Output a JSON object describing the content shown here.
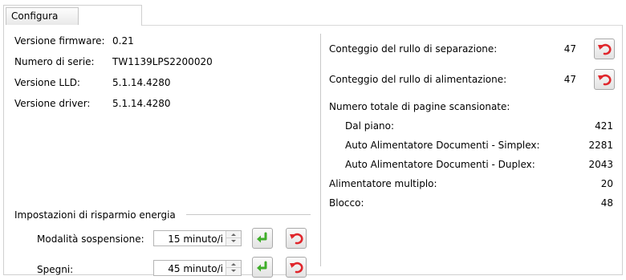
{
  "tabs": [
    {
      "label": "Configura",
      "selected": true
    }
  ],
  "device_info": {
    "firmware_label": "Versione firmware:",
    "firmware_value": "0.21",
    "serial_label": "Numero di serie:",
    "serial_value": "TW1139LPS2200020",
    "lld_label": "Versione LLD:",
    "lld_value": "5.1.14.4280",
    "driver_label": "Versione driver:",
    "driver_value": "5.1.14.4280"
  },
  "power_saving": {
    "title": "Impostazioni di risparmio energia",
    "sleep_label": "Modalità sospensione:",
    "sleep_value": "15 minuto/i",
    "off_label": "Spegni:",
    "off_value": "45 minuto/i"
  },
  "counters": {
    "separation_label": "Conteggio del rullo di separazione:",
    "separation_value": "47",
    "feed_label": "Conteggio del rullo di alimentazione:",
    "feed_value": "47",
    "total_pages_label": "Numero totale di pagine scansionate:",
    "flatbed_label": "Dal piano:",
    "flatbed_value": "421",
    "adf_simplex_label": "Auto Alimentatore Documenti - Simplex:",
    "adf_simplex_value": "2281",
    "adf_duplex_label": "Auto Alimentatore Documenti - Duplex:",
    "adf_duplex_value": "2043",
    "multifeed_label": "Alimentatore multiplo:",
    "multifeed_value": "20",
    "jam_label": "Blocco:",
    "jam_value": "48"
  },
  "icons": {
    "apply": "enter-arrow-icon",
    "reset": "undo-arrow-icon",
    "apply_color": "#3fae2a",
    "reset_color": "#e0262c"
  }
}
